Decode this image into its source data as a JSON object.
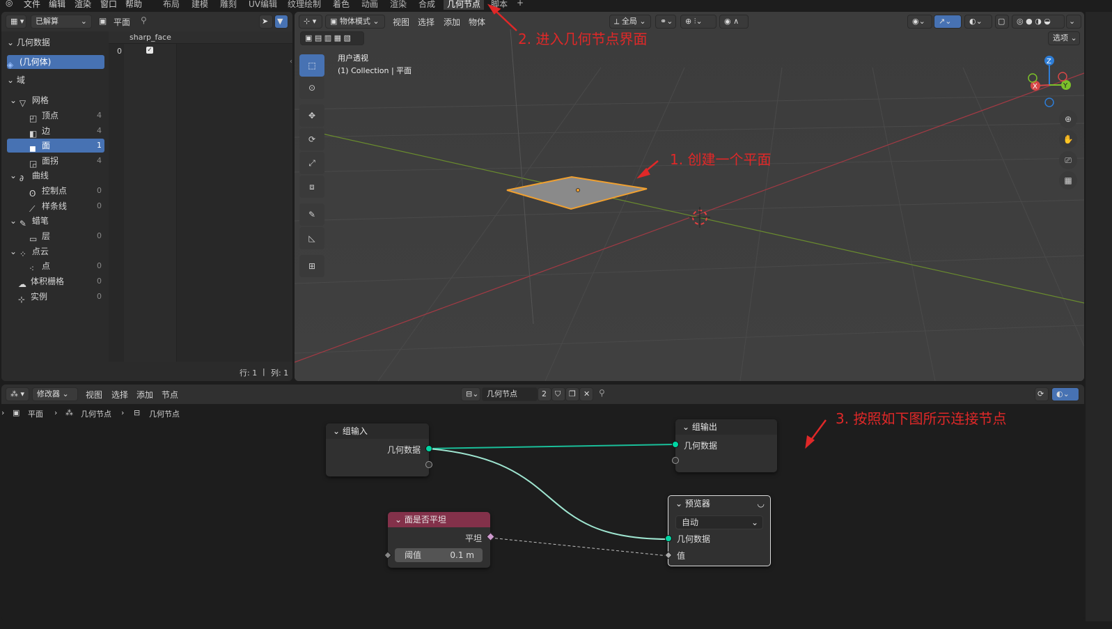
{
  "topbar": {
    "menus": [
      "文件",
      "编辑",
      "渲染",
      "窗口",
      "帮助"
    ],
    "workspaces": [
      "布局",
      "建模",
      "雕刻",
      "UV编辑",
      "纹理绘制",
      "着色",
      "动画",
      "渲染",
      "合成",
      "几何节点",
      "脚本"
    ],
    "active_workspace": "几何节点",
    "add_tab": "+"
  },
  "spreadsheet": {
    "eval_mode": "已解算",
    "object": "平面",
    "section_title": "几何数据",
    "geometry_item": "(几何体)",
    "domain_title": "域",
    "tree": [
      {
        "label": "网格",
        "count": ""
      },
      {
        "label": "顶点",
        "count": "4"
      },
      {
        "label": "边",
        "count": "4"
      },
      {
        "label": "面",
        "count": "1"
      },
      {
        "label": "面拐",
        "count": "4"
      },
      {
        "label": "曲线",
        "count": ""
      },
      {
        "label": "控制点",
        "count": "0"
      },
      {
        "label": "样条线",
        "count": "0"
      },
      {
        "label": "蜡笔",
        "count": ""
      },
      {
        "label": "层",
        "count": "0"
      },
      {
        "label": "点云",
        "count": ""
      },
      {
        "label": "点",
        "count": "0"
      },
      {
        "label": "体积栅格",
        "count": "0"
      },
      {
        "label": "实例",
        "count": "0"
      }
    ],
    "column_header": "sharp_face",
    "row_index": "0",
    "footer_rows": "行: 1",
    "footer_sep": "|",
    "footer_cols": "列: 1"
  },
  "viewport": {
    "mode": "物体模式",
    "menus": [
      "视图",
      "选择",
      "添加",
      "物体"
    ],
    "transform_orientation": "全局",
    "options_label": "选项",
    "view_name": "用户透视",
    "collection_info": "(1) Collection | 平面",
    "axes": {
      "x": "X",
      "y": "Y",
      "z": "Z"
    }
  },
  "node_editor": {
    "editor_type": "修改器",
    "menus": [
      "视图",
      "选择",
      "添加",
      "节点"
    ],
    "tree_name": "几何节点",
    "users_count": "2",
    "breadcrumb": [
      "平面",
      "几何节点",
      "几何节点"
    ],
    "nodes": {
      "group_input": {
        "title": "组输入",
        "output": "几何数据"
      },
      "group_output": {
        "title": "组输出",
        "input": "几何数据"
      },
      "is_flat": {
        "title": "面是否平坦",
        "output": "平坦",
        "param_label": "阈值",
        "param_value": "0.1 m"
      },
      "viewer": {
        "title": "预览器",
        "domain": "自动",
        "input_geo": "几何数据",
        "input_val": "值"
      }
    }
  },
  "annotations": {
    "step1": "1. 创建一个平面",
    "step2": "2. 进入几何节点界面",
    "step3": "3. 按照如下图所示连接节点"
  },
  "colors": {
    "accent": "#4772b3",
    "selection_orange": "#f0a030",
    "annotation_red": "#e02828",
    "geometry_socket": "#00d6a3",
    "field_socket": "#cc99cc",
    "is_flat_header": "#83314a"
  }
}
